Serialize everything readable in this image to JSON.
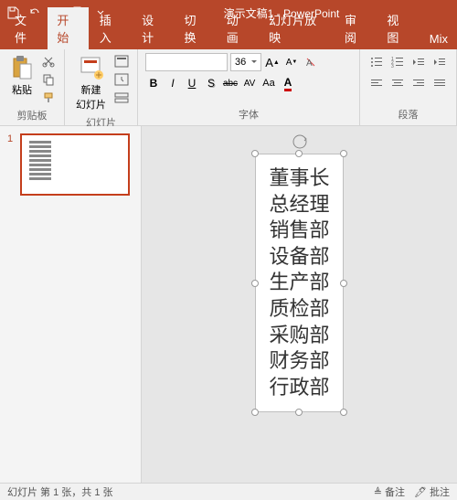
{
  "titlebar": {
    "title": "演示文稿1 - PowerPoint"
  },
  "tabs": [
    "文件",
    "开始",
    "插入",
    "设计",
    "切换",
    "动画",
    "幻灯片放映",
    "审阅",
    "视图",
    "Mix"
  ],
  "active_tab": 1,
  "ribbon": {
    "clipboard": {
      "label": "剪贴板",
      "paste": "粘贴"
    },
    "slides": {
      "label": "幻灯片",
      "new_slide": "新建\n幻灯片"
    },
    "font": {
      "label": "字体",
      "size": "36",
      "bold": "B",
      "italic": "I",
      "underline": "U",
      "shadow": "S",
      "strike": "abc",
      "spacing": "AV",
      "case": "Aa"
    },
    "paragraph": {
      "label": "段落"
    }
  },
  "slide": {
    "number": "1",
    "lines": [
      "董事长",
      "总经理",
      "销售部",
      "设备部",
      "生产部",
      "质检部",
      "采购部",
      "财务部",
      "行政部"
    ]
  },
  "statusbar": {
    "left": "幻灯片 第 1 张，共 1 张",
    "notes": "备注",
    "comments": "批注"
  }
}
